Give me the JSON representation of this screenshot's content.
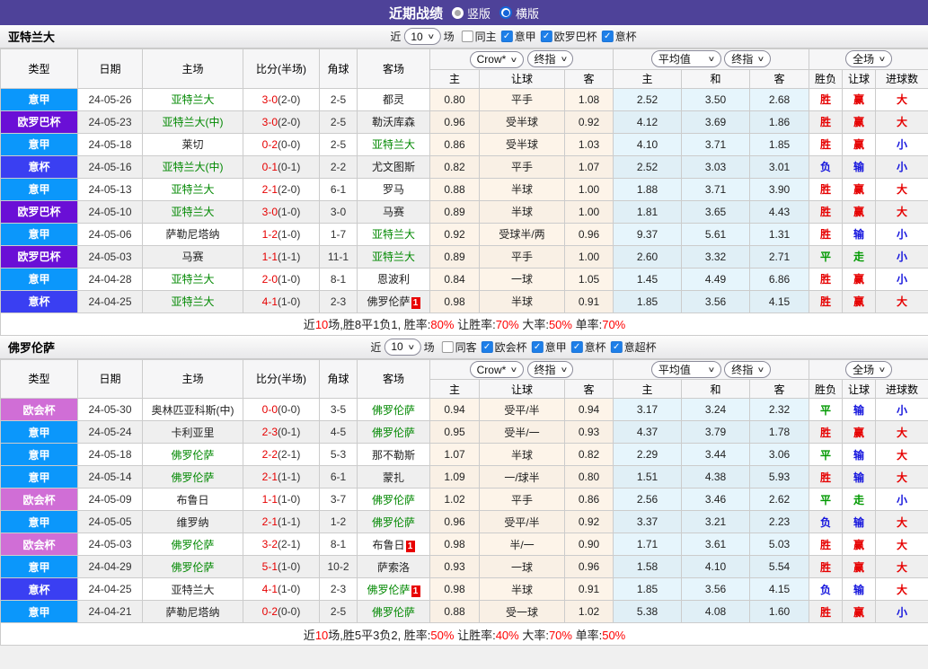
{
  "titlebar": {
    "title": "近期战绩",
    "vertical_label": "竖版",
    "vertical_selected": false,
    "horizontal_label": "横版",
    "horizontal_selected": true,
    "bar_color": "#4e4299"
  },
  "ui": {
    "recent_prefix": "近",
    "recent_suffix": "场"
  },
  "league_colors": {
    "意甲": "#0b97fb",
    "欧罗巴杯": "#6a0fd6",
    "意杯": "#3a3ff2",
    "欧会杯": "#d06ed6"
  },
  "table_header": {
    "col_type": "类型",
    "col_date": "日期",
    "col_home": "主场",
    "col_score": "比分(半场)",
    "col_corner": "角球",
    "col_away": "客场",
    "dd_crow": "Crow*",
    "dd_final": "终指",
    "dd_avg": "平均值",
    "dd_final2": "终指",
    "dd_full": "全场",
    "sub_home": "主",
    "sub_handicap": "让球",
    "sub_away": "客",
    "sub_avg_home": "主",
    "sub_avg_draw": "和",
    "sub_avg_away": "客",
    "sub_result": "胜负",
    "sub_result_handicap": "让球",
    "sub_goals": "进球数"
  },
  "sections": [
    {
      "team": "亚特兰大",
      "filter": {
        "matches": "10",
        "same": "同主",
        "same_checked": false,
        "leagues": [
          "意甲",
          "欧罗巴杯",
          "意杯"
        ]
      },
      "rows": [
        {
          "type": "意甲",
          "date": "24-05-26",
          "home": "亚特兰大",
          "hg": true,
          "score": "3-0",
          "half": "(2-0)",
          "corner": "2-5",
          "away": "都灵",
          "ag": false,
          "odds": [
            "0.80",
            "平手",
            "1.08"
          ],
          "avg": [
            "2.52",
            "3.50",
            "2.68"
          ],
          "res": [
            [
              "胜",
              "r"
            ],
            [
              "赢",
              "r"
            ],
            [
              "大",
              "r"
            ]
          ]
        },
        {
          "type": "欧罗巴杯",
          "date": "24-05-23",
          "home": "亚特兰大(中)",
          "hg": true,
          "score": "3-0",
          "half": "(2-0)",
          "corner": "2-5",
          "away": "勒沃库森",
          "ag": false,
          "odds": [
            "0.96",
            "受半球",
            "0.92"
          ],
          "avg": [
            "4.12",
            "3.69",
            "1.86"
          ],
          "res": [
            [
              "胜",
              "r"
            ],
            [
              "赢",
              "r"
            ],
            [
              "大",
              "r"
            ]
          ]
        },
        {
          "type": "意甲",
          "date": "24-05-18",
          "home": "莱切",
          "hg": false,
          "score": "0-2",
          "half": "(0-0)",
          "corner": "2-5",
          "away": "亚特兰大",
          "ag": true,
          "odds": [
            "0.86",
            "受半球",
            "1.03"
          ],
          "avg": [
            "4.10",
            "3.71",
            "1.85"
          ],
          "res": [
            [
              "胜",
              "r"
            ],
            [
              "赢",
              "r"
            ],
            [
              "小",
              "b"
            ]
          ]
        },
        {
          "type": "意杯",
          "date": "24-05-16",
          "home": "亚特兰大(中)",
          "hg": true,
          "score": "0-1",
          "half": "(0-1)",
          "corner": "2-2",
          "away": "尤文图斯",
          "ag": false,
          "odds": [
            "0.82",
            "平手",
            "1.07"
          ],
          "avg": [
            "2.52",
            "3.03",
            "3.01"
          ],
          "res": [
            [
              "负",
              "b"
            ],
            [
              "输",
              "b"
            ],
            [
              "小",
              "b"
            ]
          ]
        },
        {
          "type": "意甲",
          "date": "24-05-13",
          "home": "亚特兰大",
          "hg": true,
          "score": "2-1",
          "half": "(2-0)",
          "corner": "6-1",
          "away": "罗马",
          "ag": false,
          "odds": [
            "0.88",
            "半球",
            "1.00"
          ],
          "avg": [
            "1.88",
            "3.71",
            "3.90"
          ],
          "res": [
            [
              "胜",
              "r"
            ],
            [
              "赢",
              "r"
            ],
            [
              "大",
              "r"
            ]
          ]
        },
        {
          "type": "欧罗巴杯",
          "date": "24-05-10",
          "home": "亚特兰大",
          "hg": true,
          "score": "3-0",
          "half": "(1-0)",
          "corner": "3-0",
          "away": "马赛",
          "ag": false,
          "odds": [
            "0.89",
            "半球",
            "1.00"
          ],
          "avg": [
            "1.81",
            "3.65",
            "4.43"
          ],
          "res": [
            [
              "胜",
              "r"
            ],
            [
              "赢",
              "r"
            ],
            [
              "大",
              "r"
            ]
          ]
        },
        {
          "type": "意甲",
          "date": "24-05-06",
          "home": "萨勒尼塔纳",
          "hg": false,
          "score": "1-2",
          "half": "(1-0)",
          "corner": "1-7",
          "away": "亚特兰大",
          "ag": true,
          "odds": [
            "0.92",
            "受球半/两",
            "0.96"
          ],
          "avg": [
            "9.37",
            "5.61",
            "1.31"
          ],
          "res": [
            [
              "胜",
              "r"
            ],
            [
              "输",
              "b"
            ],
            [
              "小",
              "b"
            ]
          ]
        },
        {
          "type": "欧罗巴杯",
          "date": "24-05-03",
          "home": "马赛",
          "hg": false,
          "score": "1-1",
          "half": "(1-1)",
          "corner": "11-1",
          "away": "亚特兰大",
          "ag": true,
          "odds": [
            "0.89",
            "平手",
            "1.00"
          ],
          "avg": [
            "2.60",
            "3.32",
            "2.71"
          ],
          "res": [
            [
              "平",
              "g"
            ],
            [
              "走",
              "g"
            ],
            [
              "小",
              "b"
            ]
          ]
        },
        {
          "type": "意甲",
          "date": "24-04-28",
          "home": "亚特兰大",
          "hg": true,
          "score": "2-0",
          "half": "(1-0)",
          "corner": "8-1",
          "away": "恩波利",
          "ag": false,
          "odds": [
            "0.84",
            "一球",
            "1.05"
          ],
          "avg": [
            "1.45",
            "4.49",
            "6.86"
          ],
          "res": [
            [
              "胜",
              "r"
            ],
            [
              "赢",
              "r"
            ],
            [
              "小",
              "b"
            ]
          ]
        },
        {
          "type": "意杯",
          "date": "24-04-25",
          "home": "亚特兰大",
          "hg": true,
          "score": "4-1",
          "half": "(1-0)",
          "corner": "2-3",
          "away": "佛罗伦萨",
          "ag": false,
          "ac": "1",
          "odds": [
            "0.98",
            "半球",
            "0.91"
          ],
          "avg": [
            "1.85",
            "3.56",
            "4.15"
          ],
          "res": [
            [
              "胜",
              "r"
            ],
            [
              "赢",
              "r"
            ],
            [
              "大",
              "r"
            ]
          ]
        }
      ],
      "summary": [
        [
          "近",
          "k"
        ],
        [
          "10",
          "r"
        ],
        [
          "场,胜8平1负1, 胜率:",
          "k"
        ],
        [
          "80%",
          "r"
        ],
        [
          " 让胜率:",
          "k"
        ],
        [
          "70%",
          "r"
        ],
        [
          " 大率:",
          "k"
        ],
        [
          "50%",
          "r"
        ],
        [
          " 单率:",
          "k"
        ],
        [
          "70%",
          "r"
        ]
      ]
    },
    {
      "team": "佛罗伦萨",
      "filter": {
        "matches": "10",
        "same": "同客",
        "same_checked": false,
        "leagues": [
          "欧会杯",
          "意甲",
          "意杯",
          "意超杯"
        ]
      },
      "rows": [
        {
          "type": "欧会杯",
          "date": "24-05-30",
          "home": "奥林匹亚科斯(中)",
          "hg": false,
          "score": "0-0",
          "half": "(0-0)",
          "corner": "3-5",
          "away": "佛罗伦萨",
          "ag": true,
          "odds": [
            "0.94",
            "受平/半",
            "0.94"
          ],
          "avg": [
            "3.17",
            "3.24",
            "2.32"
          ],
          "res": [
            [
              "平",
              "g"
            ],
            [
              "输",
              "b"
            ],
            [
              "小",
              "b"
            ]
          ]
        },
        {
          "type": "意甲",
          "date": "24-05-24",
          "home": "卡利亚里",
          "hg": false,
          "score": "2-3",
          "half": "(0-1)",
          "corner": "4-5",
          "away": "佛罗伦萨",
          "ag": true,
          "odds": [
            "0.95",
            "受半/一",
            "0.93"
          ],
          "avg": [
            "4.37",
            "3.79",
            "1.78"
          ],
          "res": [
            [
              "胜",
              "r"
            ],
            [
              "赢",
              "r"
            ],
            [
              "大",
              "r"
            ]
          ]
        },
        {
          "type": "意甲",
          "date": "24-05-18",
          "home": "佛罗伦萨",
          "hg": true,
          "score": "2-2",
          "half": "(2-1)",
          "corner": "5-3",
          "away": "那不勒斯",
          "ag": false,
          "odds": [
            "1.07",
            "半球",
            "0.82"
          ],
          "avg": [
            "2.29",
            "3.44",
            "3.06"
          ],
          "res": [
            [
              "平",
              "g"
            ],
            [
              "输",
              "b"
            ],
            [
              "大",
              "r"
            ]
          ]
        },
        {
          "type": "意甲",
          "date": "24-05-14",
          "home": "佛罗伦萨",
          "hg": true,
          "score": "2-1",
          "half": "(1-1)",
          "corner": "6-1",
          "away": "蒙扎",
          "ag": false,
          "odds": [
            "1.09",
            "一/球半",
            "0.80"
          ],
          "avg": [
            "1.51",
            "4.38",
            "5.93"
          ],
          "res": [
            [
              "胜",
              "r"
            ],
            [
              "输",
              "b"
            ],
            [
              "大",
              "r"
            ]
          ]
        },
        {
          "type": "欧会杯",
          "date": "24-05-09",
          "home": "布鲁日",
          "hg": false,
          "score": "1-1",
          "half": "(1-0)",
          "corner": "3-7",
          "away": "佛罗伦萨",
          "ag": true,
          "odds": [
            "1.02",
            "平手",
            "0.86"
          ],
          "avg": [
            "2.56",
            "3.46",
            "2.62"
          ],
          "res": [
            [
              "平",
              "g"
            ],
            [
              "走",
              "g"
            ],
            [
              "小",
              "b"
            ]
          ]
        },
        {
          "type": "意甲",
          "date": "24-05-05",
          "home": "维罗纳",
          "hg": false,
          "score": "2-1",
          "half": "(1-1)",
          "corner": "1-2",
          "away": "佛罗伦萨",
          "ag": true,
          "odds": [
            "0.96",
            "受平/半",
            "0.92"
          ],
          "avg": [
            "3.37",
            "3.21",
            "2.23"
          ],
          "res": [
            [
              "负",
              "b"
            ],
            [
              "输",
              "b"
            ],
            [
              "大",
              "r"
            ]
          ]
        },
        {
          "type": "欧会杯",
          "date": "24-05-03",
          "home": "佛罗伦萨",
          "hg": true,
          "score": "3-2",
          "half": "(2-1)",
          "corner": "8-1",
          "away": "布鲁日",
          "ag": false,
          "ac": "1",
          "odds": [
            "0.98",
            "半/一",
            "0.90"
          ],
          "avg": [
            "1.71",
            "3.61",
            "5.03"
          ],
          "res": [
            [
              "胜",
              "r"
            ],
            [
              "赢",
              "r"
            ],
            [
              "大",
              "r"
            ]
          ]
        },
        {
          "type": "意甲",
          "date": "24-04-29",
          "home": "佛罗伦萨",
          "hg": true,
          "score": "5-1",
          "half": "(1-0)",
          "corner": "10-2",
          "away": "萨索洛",
          "ag": false,
          "odds": [
            "0.93",
            "一球",
            "0.96"
          ],
          "avg": [
            "1.58",
            "4.10",
            "5.54"
          ],
          "res": [
            [
              "胜",
              "r"
            ],
            [
              "赢",
              "r"
            ],
            [
              "大",
              "r"
            ]
          ]
        },
        {
          "type": "意杯",
          "date": "24-04-25",
          "home": "亚特兰大",
          "hg": false,
          "score": "4-1",
          "half": "(1-0)",
          "corner": "2-3",
          "away": "佛罗伦萨",
          "ag": true,
          "ac": "1",
          "odds": [
            "0.98",
            "半球",
            "0.91"
          ],
          "avg": [
            "1.85",
            "3.56",
            "4.15"
          ],
          "res": [
            [
              "负",
              "b"
            ],
            [
              "输",
              "b"
            ],
            [
              "大",
              "r"
            ]
          ]
        },
        {
          "type": "意甲",
          "date": "24-04-21",
          "home": "萨勒尼塔纳",
          "hg": false,
          "score": "0-2",
          "half": "(0-0)",
          "corner": "2-5",
          "away": "佛罗伦萨",
          "ag": true,
          "odds": [
            "0.88",
            "受一球",
            "1.02"
          ],
          "avg": [
            "5.38",
            "4.08",
            "1.60"
          ],
          "res": [
            [
              "胜",
              "r"
            ],
            [
              "赢",
              "r"
            ],
            [
              "小",
              "b"
            ]
          ]
        }
      ],
      "summary": [
        [
          "近",
          "k"
        ],
        [
          "10",
          "r"
        ],
        [
          "场,胜5平3负2, 胜率:",
          "k"
        ],
        [
          "50%",
          "r"
        ],
        [
          " 让胜率:",
          "k"
        ],
        [
          "40%",
          "r"
        ],
        [
          " 大率:",
          "k"
        ],
        [
          "70%",
          "r"
        ],
        [
          " 单率:",
          "k"
        ],
        [
          "50%",
          "r"
        ]
      ]
    }
  ]
}
